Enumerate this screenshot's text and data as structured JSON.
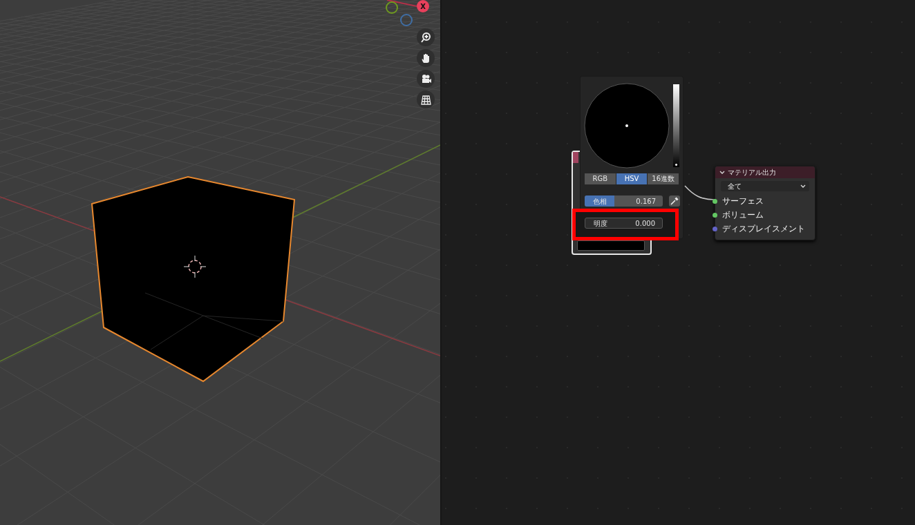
{
  "viewport": {
    "gizmo": [
      {
        "label": "X",
        "color": "#e8405c"
      },
      {
        "color": "#6f9a1f"
      },
      {
        "color": "#3f6ea5"
      }
    ]
  },
  "color_picker": {
    "value_slider": {
      "level": 0
    },
    "modes": [
      {
        "label": "RGB",
        "selected": false
      },
      {
        "label": "HSV",
        "selected": true
      },
      {
        "label": "16進数",
        "selected": false
      }
    ],
    "fields": [
      {
        "label": "色相",
        "value": "0.167",
        "level": 0.38,
        "highlighted": false
      },
      {
        "label": "明度",
        "value": "0.000",
        "level": 0,
        "highlighted": true
      }
    ]
  },
  "material_output": {
    "title": "マテリアル出力",
    "expanded": true,
    "target": "全て",
    "sockets": [
      {
        "label": "サーフェス",
        "color": "#63c763"
      },
      {
        "label": "ボリューム",
        "color": "#63c763"
      },
      {
        "label": "ディスプレイスメント",
        "color": "#6363c7"
      }
    ]
  }
}
